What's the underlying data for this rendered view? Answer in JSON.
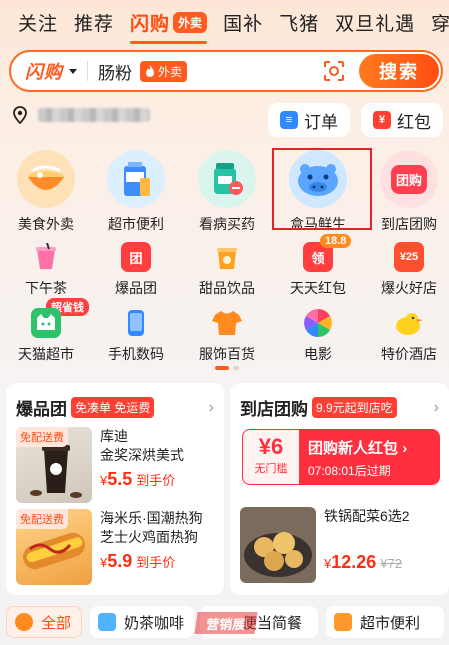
{
  "tabs": [
    "关注",
    "推荐",
    "闪购",
    "国补",
    "飞猪",
    "双旦礼遇",
    "穿"
  ],
  "active_tab_badge": "外卖",
  "search": {
    "logo": "闪购",
    "query": "肠粉",
    "tag": "外卖",
    "button": "搜索"
  },
  "header_pills": {
    "order": "订单",
    "red_packet": "红包"
  },
  "categories": [
    {
      "label": "美食外卖",
      "icon": "noodle-bowl-icon"
    },
    {
      "label": "超市便利",
      "icon": "supermarket-icon"
    },
    {
      "label": "看病买药",
      "icon": "medicine-icon"
    },
    {
      "label": "盒马鲜生",
      "icon": "hippo-icon"
    },
    {
      "label": "到店团购",
      "icon": "group-buy-icon",
      "icon_text": "团购"
    }
  ],
  "mini_row1": [
    {
      "label": "下午茶",
      "icon": "drink-cup-icon"
    },
    {
      "label": "爆品团",
      "icon": "hot-group-icon",
      "icon_text": "团"
    },
    {
      "label": "甜品饮品",
      "icon": "dessert-icon"
    },
    {
      "label": "天天红包",
      "icon": "red-packet-icon",
      "icon_text": "领",
      "badge": "18.8"
    },
    {
      "label": "爆火好店",
      "icon": "fire-shop-icon",
      "icon_text": "¥25"
    }
  ],
  "mini_row2": [
    {
      "label": "天猫超市",
      "icon": "tmall-cat-icon",
      "badge": "超省钱"
    },
    {
      "label": "手机数码",
      "icon": "phone-icon"
    },
    {
      "label": "服饰百货",
      "icon": "shirt-icon"
    },
    {
      "label": "电影",
      "icon": "movie-icon"
    },
    {
      "label": "特价酒店",
      "icon": "hotel-duck-icon"
    }
  ],
  "left_card": {
    "title": "爆品团",
    "tag": "免凑单 免运费",
    "items": [
      {
        "ship": "免配送费",
        "name": "库迪\n金奖深烘美式",
        "price": "5.5",
        "suffix": "到手价"
      },
      {
        "ship": "免配送费",
        "name": "海米乐·国潮热狗\n芝士火鸡面热狗",
        "price": "5.9",
        "suffix": "到手价"
      }
    ]
  },
  "right_card": {
    "title": "到店团购",
    "tag": "9.9元起到店吃",
    "coupon": {
      "amount": "¥6",
      "amount_label": "无门槛",
      "title": "团购新人红包",
      "countdown": "07:08:01后过期"
    },
    "item": {
      "name": "铁锅配菜6选2",
      "price": "12.26",
      "orig": "¥72"
    }
  },
  "bottom_chips": [
    {
      "label": "全部"
    },
    {
      "label": "奶茶咖啡"
    },
    {
      "label": "便当简餐"
    },
    {
      "label": "超市便利"
    }
  ],
  "watermark": "营销展",
  "colors": {
    "accent": "#ff5a1f",
    "price_red": "#ff2e12",
    "highlight_box": "#e8202a"
  }
}
